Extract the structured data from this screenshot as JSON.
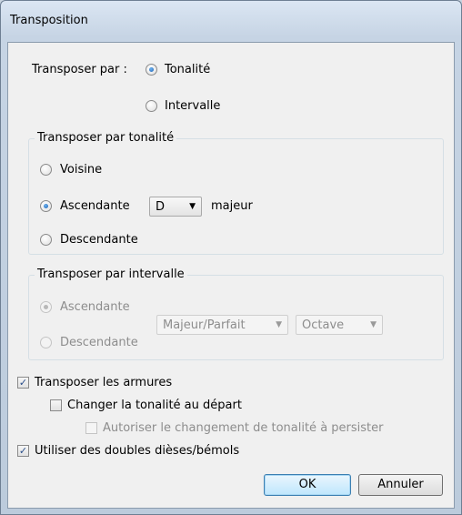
{
  "window": {
    "title": "Transposition"
  },
  "transpose_by": {
    "label": "Transposer par :",
    "options": [
      {
        "label": "Tonalité",
        "checked": true
      },
      {
        "label": "Intervalle",
        "checked": false
      }
    ]
  },
  "by_key": {
    "legend": "Transposer par tonalité",
    "options": [
      {
        "label": "Voisine",
        "checked": false
      },
      {
        "label": "Ascendante",
        "checked": true
      },
      {
        "label": "Descendante",
        "checked": false
      }
    ],
    "key_select": {
      "value": "D"
    },
    "mode_label": "majeur"
  },
  "by_interval": {
    "legend": "Transposer par intervalle",
    "options": [
      {
        "label": "Ascendante",
        "checked": true,
        "disabled": true
      },
      {
        "label": "Descendante",
        "checked": false,
        "disabled": true
      }
    ],
    "quality_select": {
      "value": "Majeur/Parfait",
      "disabled": true
    },
    "interval_select": {
      "value": "Octave",
      "disabled": true
    }
  },
  "checkboxes": [
    {
      "label": "Transposer les armures",
      "checked": true,
      "disabled": false
    },
    {
      "label": "Changer la tonalité au départ",
      "checked": false,
      "disabled": false
    },
    {
      "label": "Autoriser le changement de tonalité à persister",
      "checked": false,
      "disabled": true
    },
    {
      "label": "Utiliser des doubles dièses/bémols",
      "checked": true,
      "disabled": false
    }
  ],
  "buttons": {
    "ok": "OK",
    "cancel": "Annuler"
  }
}
